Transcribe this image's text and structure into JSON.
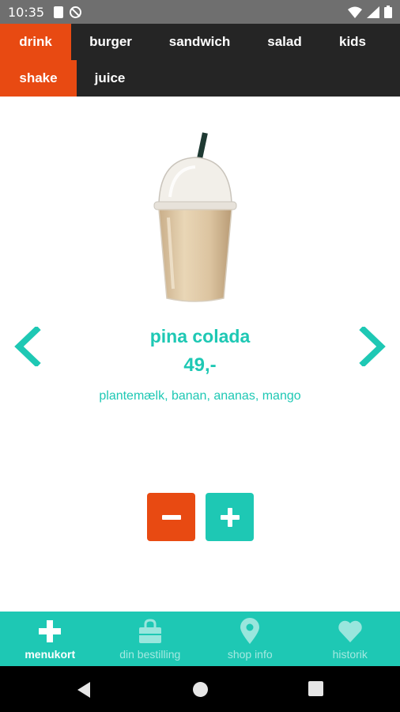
{
  "status_bar": {
    "time": "10:35",
    "left_icons": [
      "sd-card-icon",
      "no-disturb-icon"
    ],
    "right_icons": [
      "wifi-icon",
      "signal-icon",
      "battery-icon"
    ]
  },
  "categories": {
    "row1": [
      "drink",
      "burger",
      "sandwich",
      "salad",
      "kids"
    ],
    "row2": [
      "shake",
      "juice"
    ],
    "active_main": "drink",
    "active_sub": "shake",
    "active_color": "#e84a12",
    "bar_color": "#252525"
  },
  "product": {
    "name": "pina colada",
    "price": "49,-",
    "description": "plantemælk, banan, ananas, mango",
    "image": "smoothie-cup-image"
  },
  "controls": {
    "minus_icon": "minus-icon",
    "plus_icon": "plus-icon",
    "minus_color": "#e84a12",
    "plus_color": "#1ec8b4"
  },
  "bottom_nav": {
    "items": [
      {
        "label": "menukort",
        "icon": "plus-icon"
      },
      {
        "label": "din bestilling",
        "icon": "shopping-bag-icon"
      },
      {
        "label": "shop info",
        "icon": "location-pin-icon"
      },
      {
        "label": "historik",
        "icon": "heart-icon"
      }
    ],
    "active": "menukort",
    "color": "#1ec8b4"
  },
  "system_nav": [
    "back-icon",
    "home-icon",
    "recents-icon"
  ]
}
